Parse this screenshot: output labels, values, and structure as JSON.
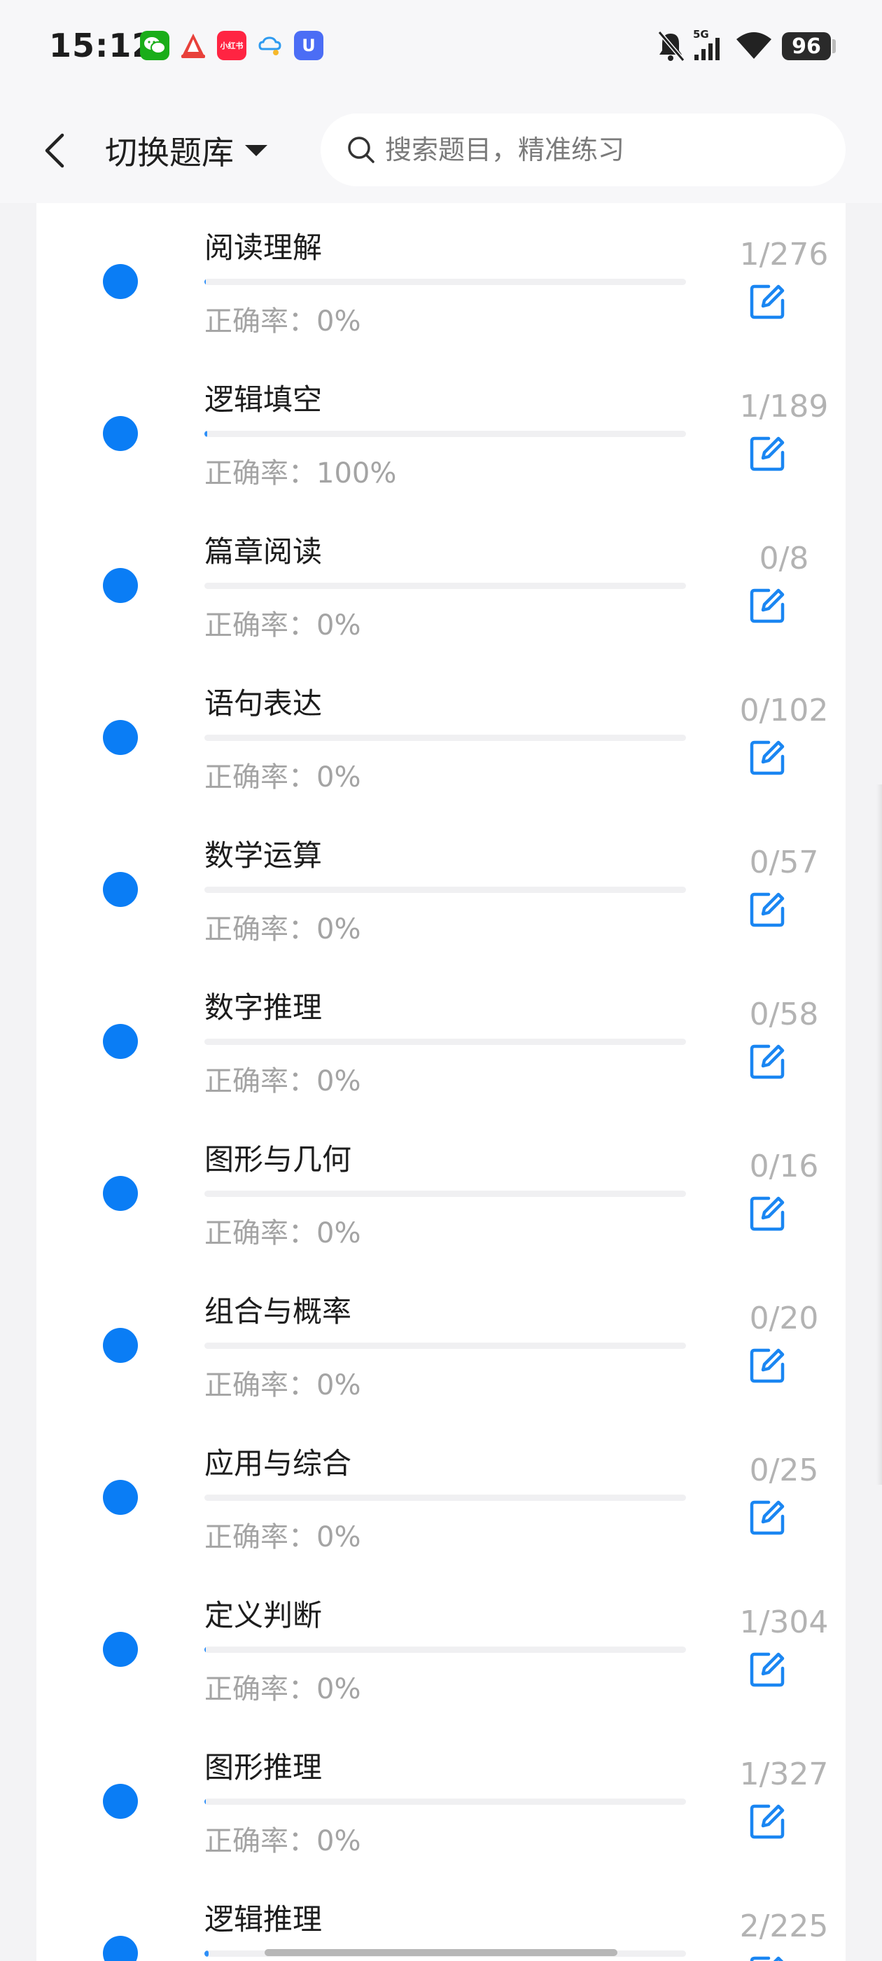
{
  "status_bar": {
    "time": "15:12",
    "apps": [
      {
        "name": "wechat-icon",
        "text": ""
      },
      {
        "name": "sail-app-icon",
        "text": ""
      },
      {
        "name": "xiaohongshu-icon",
        "text": "小红书"
      },
      {
        "name": "cloud-chat-icon",
        "text": ""
      },
      {
        "name": "guard-app-icon",
        "text": "U"
      }
    ],
    "network": "5G",
    "battery": "96"
  },
  "header": {
    "bank_switch_label": "切换题库",
    "search_placeholder": "搜索题目，精准练习"
  },
  "categories": [
    {
      "name": "阅读理解",
      "count": "1/276",
      "accuracy": "正确率：0%",
      "progress": 0.0036
    },
    {
      "name": "逻辑填空",
      "count": "1/189",
      "accuracy": "正确率：100%",
      "progress": 0.0053
    },
    {
      "name": "篇章阅读",
      "count": "0/8",
      "accuracy": "正确率：0%",
      "progress": 0
    },
    {
      "name": "语句表达",
      "count": "0/102",
      "accuracy": "正确率：0%",
      "progress": 0
    },
    {
      "name": "数学运算",
      "count": "0/57",
      "accuracy": "正确率：0%",
      "progress": 0
    },
    {
      "name": "数字推理",
      "count": "0/58",
      "accuracy": "正确率：0%",
      "progress": 0
    },
    {
      "name": "图形与几何",
      "count": "0/16",
      "accuracy": "正确率：0%",
      "progress": 0
    },
    {
      "name": "组合与概率",
      "count": "0/20",
      "accuracy": "正确率：0%",
      "progress": 0
    },
    {
      "name": "应用与综合",
      "count": "0/25",
      "accuracy": "正确率：0%",
      "progress": 0
    },
    {
      "name": "定义判断",
      "count": "1/304",
      "accuracy": "正确率：0%",
      "progress": 0.0033
    },
    {
      "name": "图形推理",
      "count": "1/327",
      "accuracy": "正确率：0%",
      "progress": 0.0031
    },
    {
      "name": "逻辑推理",
      "count": "2/225",
      "accuracy": "",
      "progress": 0.0089
    }
  ],
  "colors": {
    "accent": "#0a7df5",
    "muted_text": "#a4a4a4",
    "count_text": "#b3b3b3",
    "track": "#f0f0f2"
  }
}
